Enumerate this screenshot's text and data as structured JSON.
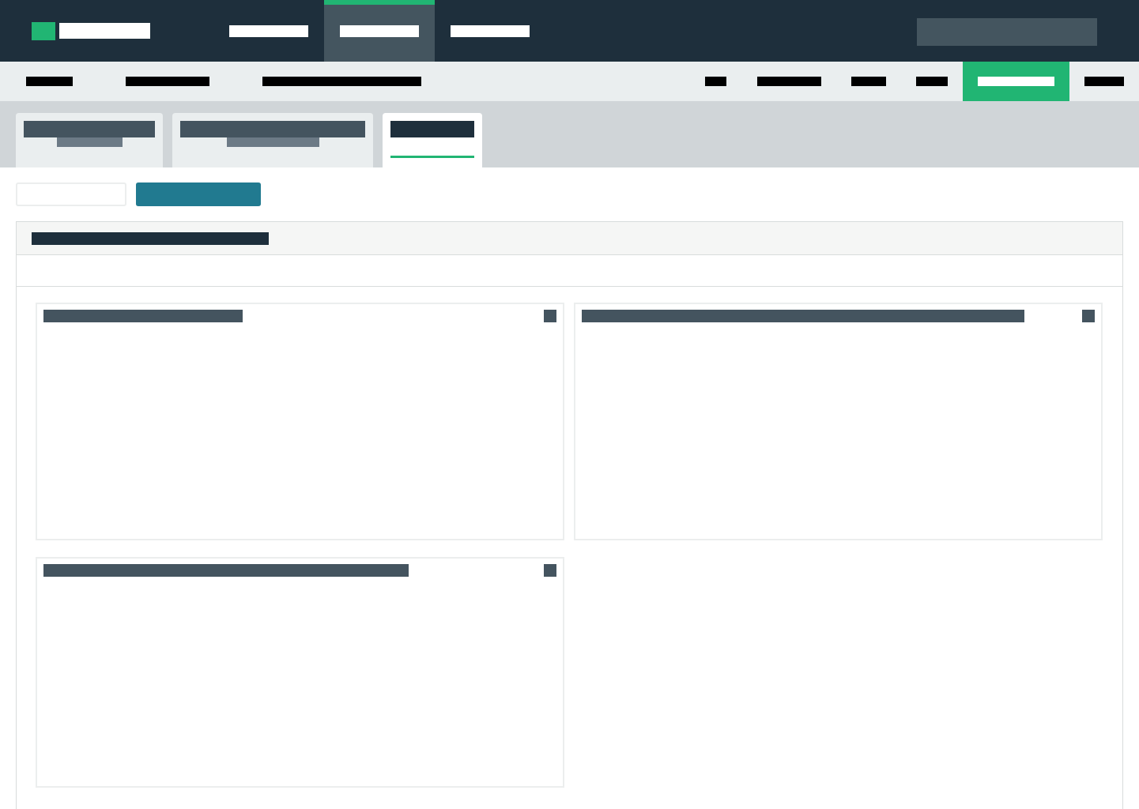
{
  "top_nav": {
    "items": [
      {
        "selected": false
      },
      {
        "selected": true
      },
      {
        "selected": false
      }
    ]
  },
  "sub_nav": {
    "left_items": [
      {
        "selected": false
      },
      {
        "selected": false
      },
      {
        "selected": false
      }
    ],
    "right_items": [
      {
        "selected": false
      },
      {
        "selected": false
      },
      {
        "selected": false
      },
      {
        "selected": false
      },
      {
        "selected": true
      },
      {
        "selected": false
      }
    ]
  },
  "page_tabs": [
    {
      "selected": false
    },
    {
      "selected": false
    },
    {
      "selected": true
    }
  ]
}
